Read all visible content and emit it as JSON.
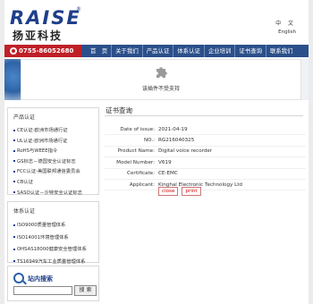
{
  "header": {
    "logo_text": "RAISE",
    "logo_reg": "®",
    "logo_cn": "扬亚科技",
    "lang_zh": "中 文",
    "lang_en": "English"
  },
  "nav": {
    "phone": "0755-86052680",
    "items": [
      "首　页",
      "关于我们",
      "产品认证",
      "体系认证",
      "企业培训",
      "证书查询",
      "联系我们"
    ]
  },
  "plugin": {
    "message": "该插件不受支持"
  },
  "sidebar": {
    "product_title": "产品认证",
    "product_items": [
      "CE认证-欧洲市场通行证",
      "UL认证-欧洲市场通行证",
      "RoHS与WEEE指令",
      "GS标志－德国安全认证标志",
      "FCC认证-美国联邦通信委员会",
      "CB认证",
      "SASO认证－沙特安全认证标志"
    ],
    "system_title": "体系认证",
    "system_items": [
      "ISO9000质量管理体系",
      "ISO14001环境管理体系",
      "OHSAS18000健康安全管理体系",
      "TS16949汽车工业质量管理体系"
    ],
    "search_title": "站内搜索",
    "search_button": "搜 索",
    "search_value": ""
  },
  "main": {
    "title": "证书查询",
    "rows": [
      {
        "label": "Date of issue:",
        "value": "2021-04-19"
      },
      {
        "label": "NO.:",
        "value": "RG216040325"
      },
      {
        "label": "Product Name:",
        "value": "Digital voice recorder"
      },
      {
        "label": "Model Number:",
        "value": "V619"
      },
      {
        "label": "Certificate:",
        "value": "CE-EMC"
      },
      {
        "label": "Applicant:",
        "value": "Kinghal Electronic Technology Ltd"
      }
    ],
    "close_label": "close",
    "print_label": "print"
  }
}
